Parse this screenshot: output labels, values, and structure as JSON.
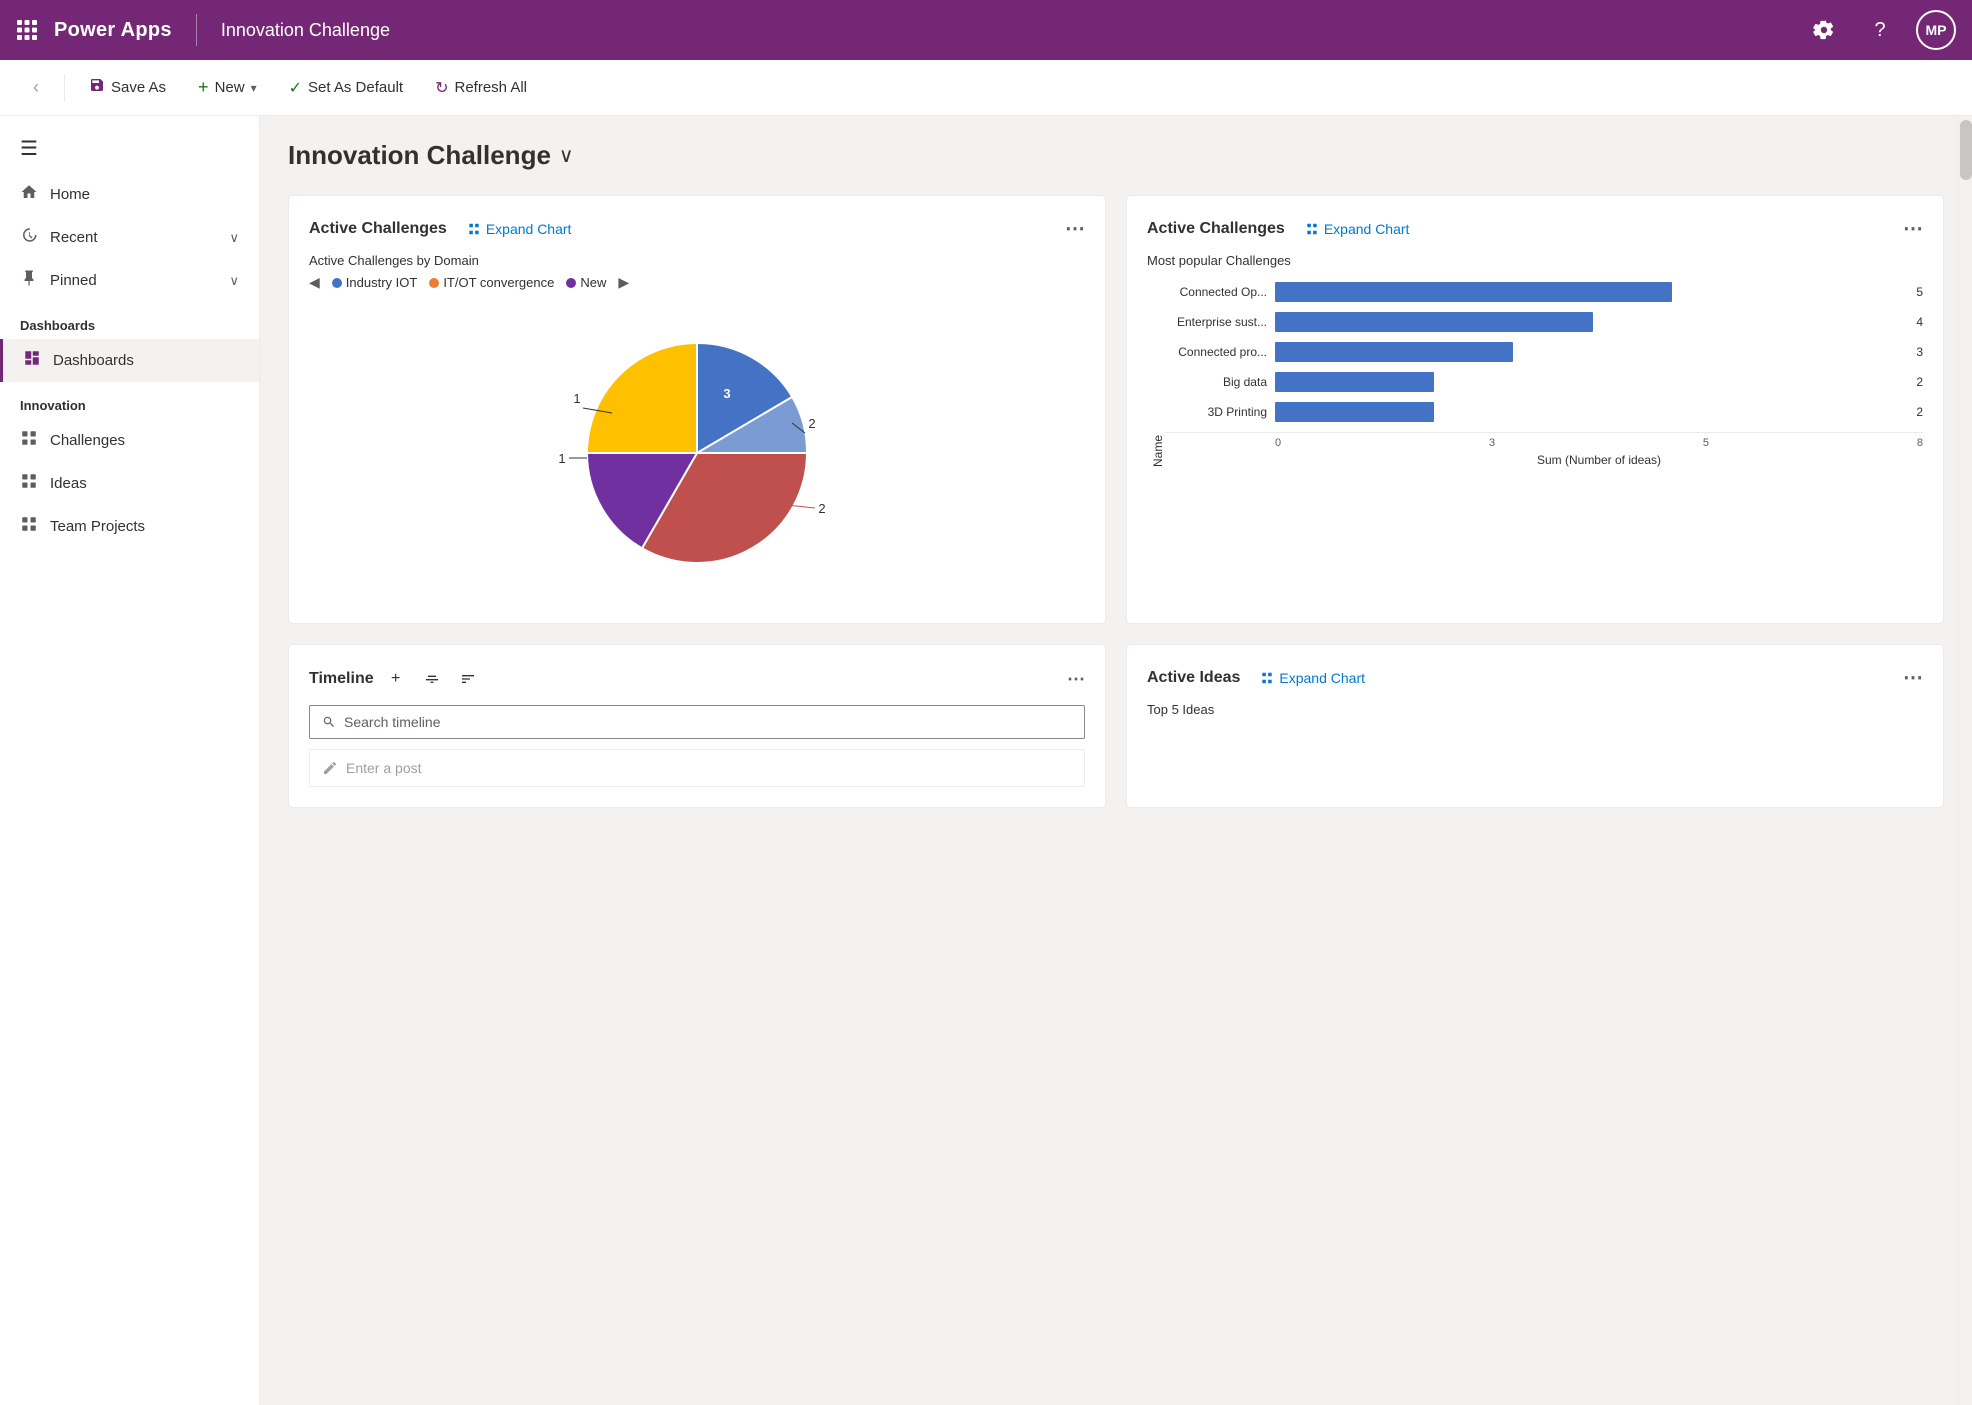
{
  "topbar": {
    "app_name": "Power Apps",
    "page_name": "Innovation Challenge",
    "avatar_initials": "MP",
    "gear_icon": "⚙",
    "help_icon": "?",
    "grid_icon": "⠿"
  },
  "toolbar": {
    "back_label": "‹",
    "save_as_label": "Save As",
    "new_label": "New",
    "set_default_label": "Set As Default",
    "refresh_all_label": "Refresh All"
  },
  "sidebar": {
    "hamburger": "☰",
    "nav_items": [
      {
        "label": "Home",
        "icon": "⌂",
        "has_chevron": false
      },
      {
        "label": "Recent",
        "icon": "◷",
        "has_chevron": true
      },
      {
        "label": "Pinned",
        "icon": "✦",
        "has_chevron": true
      }
    ],
    "dashboards_section": "Dashboards",
    "dashboards_item": "Dashboards",
    "innovation_section": "Innovation",
    "innovation_items": [
      {
        "label": "Challenges"
      },
      {
        "label": "Ideas"
      },
      {
        "label": "Team Projects"
      }
    ]
  },
  "page_title": "Innovation Challenge",
  "cards": {
    "active_challenges_pie": {
      "title": "Active Challenges",
      "expand_label": "Expand Chart",
      "subtitle": "Active Challenges by Domain",
      "legend_items": [
        {
          "label": "Industry IOT",
          "color": "#4472c4"
        },
        {
          "label": "IT/OT convergence",
          "color": "#ed7d31"
        },
        {
          "label": "New",
          "color": "#7030a0"
        }
      ],
      "pie_segments": [
        {
          "label": "3",
          "color": "#4472c4",
          "value": 3
        },
        {
          "label": "2",
          "color": "#4472c4",
          "value": 2
        },
        {
          "label": "1",
          "color": "#ffc000",
          "value": 1
        },
        {
          "label": "1",
          "color": "#7030a0",
          "value": 1
        },
        {
          "label": "2",
          "color": "#c0504d",
          "value": 2
        }
      ]
    },
    "active_challenges_bar": {
      "title": "Active Challenges",
      "expand_label": "Expand Chart",
      "subtitle": "Most popular Challenges",
      "bar_items": [
        {
          "label": "Connected Op...",
          "value": 5,
          "max": 8
        },
        {
          "label": "Enterprise sust...",
          "value": 4,
          "max": 8
        },
        {
          "label": "Connected pro...",
          "value": 3,
          "max": 8
        },
        {
          "label": "Big data",
          "value": 2,
          "max": 8
        },
        {
          "label": "3D Printing",
          "value": 2,
          "max": 8
        }
      ],
      "x_axis_labels": [
        "0",
        "3",
        "5",
        "8"
      ],
      "x_axis_title": "Sum (Number of ideas)",
      "y_axis_title": "Name"
    },
    "timeline": {
      "title": "Timeline",
      "search_placeholder": "Search timeline",
      "post_placeholder": "Enter a post"
    },
    "active_ideas": {
      "title": "Active Ideas",
      "expand_label": "Expand Chart",
      "subtitle": "Top 5 Ideas"
    }
  }
}
